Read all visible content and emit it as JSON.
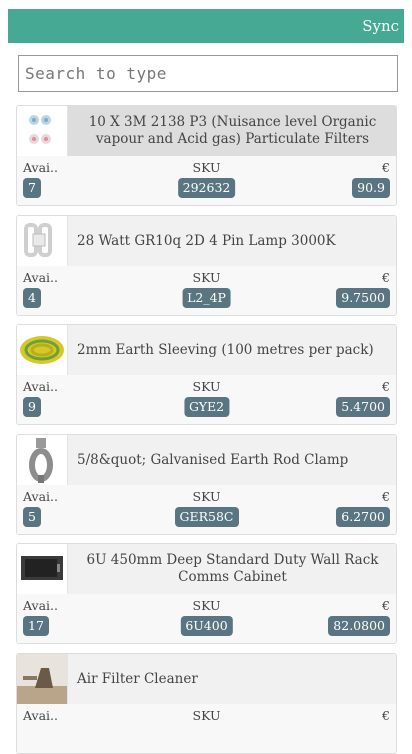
{
  "header": {
    "sync_label": "Sync"
  },
  "search": {
    "placeholder": "Search to type",
    "value": ""
  },
  "columns": {
    "availability": "Avai..",
    "sku": "SKU",
    "currency": "€"
  },
  "products": [
    {
      "title": "10 X 3M 2138 P3 (Nuisance level Organic vapour and Acid gas) Particulate Filters",
      "available": "7",
      "sku": "292632",
      "price": "90.9",
      "thumb": "filters-image"
    },
    {
      "title": "28 Watt GR10q 2D 4 Pin Lamp 3000K",
      "available": "4",
      "sku": "L2_4P",
      "price": "9.7500",
      "thumb": "lamp-image"
    },
    {
      "title": "2mm Earth Sleeving (100 metres per pack)",
      "available": "9",
      "sku": "GYE2",
      "price": "5.4700",
      "thumb": "sleeving-image"
    },
    {
      "title": "5/8&quot; Galvanised Earth Rod Clamp",
      "available": "5",
      "sku": "GER58C",
      "price": "6.2700",
      "thumb": "clamp-image"
    },
    {
      "title": "6U 450mm Deep Standard Duty Wall Rack Comms Cabinet",
      "available": "17",
      "sku": "6U400",
      "price": "82.0800",
      "thumb": "cabinet-image"
    },
    {
      "title": "Air Filter Cleaner",
      "available": "",
      "sku": "",
      "price": "",
      "thumb": "air-filter-image"
    }
  ]
}
